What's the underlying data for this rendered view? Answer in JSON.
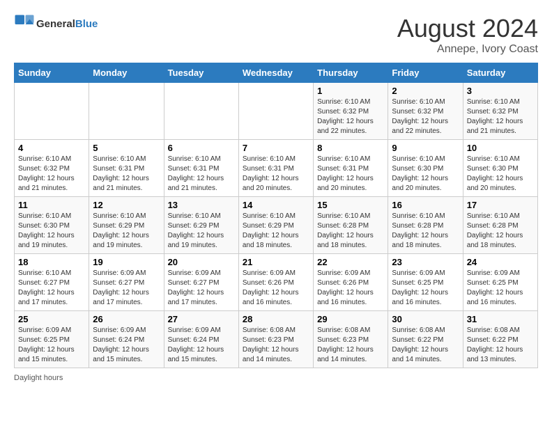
{
  "header": {
    "logo_text_general": "General",
    "logo_text_blue": "Blue",
    "month_year": "August 2024",
    "location": "Annepe, Ivory Coast"
  },
  "days_of_week": [
    "Sunday",
    "Monday",
    "Tuesday",
    "Wednesday",
    "Thursday",
    "Friday",
    "Saturday"
  ],
  "legend": "Daylight hours",
  "weeks": [
    [
      {
        "num": "",
        "info": ""
      },
      {
        "num": "",
        "info": ""
      },
      {
        "num": "",
        "info": ""
      },
      {
        "num": "",
        "info": ""
      },
      {
        "num": "1",
        "info": "Sunrise: 6:10 AM\nSunset: 6:32 PM\nDaylight: 12 hours and 22 minutes."
      },
      {
        "num": "2",
        "info": "Sunrise: 6:10 AM\nSunset: 6:32 PM\nDaylight: 12 hours and 22 minutes."
      },
      {
        "num": "3",
        "info": "Sunrise: 6:10 AM\nSunset: 6:32 PM\nDaylight: 12 hours and 21 minutes."
      }
    ],
    [
      {
        "num": "4",
        "info": "Sunrise: 6:10 AM\nSunset: 6:32 PM\nDaylight: 12 hours and 21 minutes."
      },
      {
        "num": "5",
        "info": "Sunrise: 6:10 AM\nSunset: 6:31 PM\nDaylight: 12 hours and 21 minutes."
      },
      {
        "num": "6",
        "info": "Sunrise: 6:10 AM\nSunset: 6:31 PM\nDaylight: 12 hours and 21 minutes."
      },
      {
        "num": "7",
        "info": "Sunrise: 6:10 AM\nSunset: 6:31 PM\nDaylight: 12 hours and 20 minutes."
      },
      {
        "num": "8",
        "info": "Sunrise: 6:10 AM\nSunset: 6:31 PM\nDaylight: 12 hours and 20 minutes."
      },
      {
        "num": "9",
        "info": "Sunrise: 6:10 AM\nSunset: 6:30 PM\nDaylight: 12 hours and 20 minutes."
      },
      {
        "num": "10",
        "info": "Sunrise: 6:10 AM\nSunset: 6:30 PM\nDaylight: 12 hours and 20 minutes."
      }
    ],
    [
      {
        "num": "11",
        "info": "Sunrise: 6:10 AM\nSunset: 6:30 PM\nDaylight: 12 hours and 19 minutes."
      },
      {
        "num": "12",
        "info": "Sunrise: 6:10 AM\nSunset: 6:29 PM\nDaylight: 12 hours and 19 minutes."
      },
      {
        "num": "13",
        "info": "Sunrise: 6:10 AM\nSunset: 6:29 PM\nDaylight: 12 hours and 19 minutes."
      },
      {
        "num": "14",
        "info": "Sunrise: 6:10 AM\nSunset: 6:29 PM\nDaylight: 12 hours and 18 minutes."
      },
      {
        "num": "15",
        "info": "Sunrise: 6:10 AM\nSunset: 6:28 PM\nDaylight: 12 hours and 18 minutes."
      },
      {
        "num": "16",
        "info": "Sunrise: 6:10 AM\nSunset: 6:28 PM\nDaylight: 12 hours and 18 minutes."
      },
      {
        "num": "17",
        "info": "Sunrise: 6:10 AM\nSunset: 6:28 PM\nDaylight: 12 hours and 18 minutes."
      }
    ],
    [
      {
        "num": "18",
        "info": "Sunrise: 6:10 AM\nSunset: 6:27 PM\nDaylight: 12 hours and 17 minutes."
      },
      {
        "num": "19",
        "info": "Sunrise: 6:09 AM\nSunset: 6:27 PM\nDaylight: 12 hours and 17 minutes."
      },
      {
        "num": "20",
        "info": "Sunrise: 6:09 AM\nSunset: 6:27 PM\nDaylight: 12 hours and 17 minutes."
      },
      {
        "num": "21",
        "info": "Sunrise: 6:09 AM\nSunset: 6:26 PM\nDaylight: 12 hours and 16 minutes."
      },
      {
        "num": "22",
        "info": "Sunrise: 6:09 AM\nSunset: 6:26 PM\nDaylight: 12 hours and 16 minutes."
      },
      {
        "num": "23",
        "info": "Sunrise: 6:09 AM\nSunset: 6:25 PM\nDaylight: 12 hours and 16 minutes."
      },
      {
        "num": "24",
        "info": "Sunrise: 6:09 AM\nSunset: 6:25 PM\nDaylight: 12 hours and 16 minutes."
      }
    ],
    [
      {
        "num": "25",
        "info": "Sunrise: 6:09 AM\nSunset: 6:25 PM\nDaylight: 12 hours and 15 minutes."
      },
      {
        "num": "26",
        "info": "Sunrise: 6:09 AM\nSunset: 6:24 PM\nDaylight: 12 hours and 15 minutes."
      },
      {
        "num": "27",
        "info": "Sunrise: 6:09 AM\nSunset: 6:24 PM\nDaylight: 12 hours and 15 minutes."
      },
      {
        "num": "28",
        "info": "Sunrise: 6:08 AM\nSunset: 6:23 PM\nDaylight: 12 hours and 14 minutes."
      },
      {
        "num": "29",
        "info": "Sunrise: 6:08 AM\nSunset: 6:23 PM\nDaylight: 12 hours and 14 minutes."
      },
      {
        "num": "30",
        "info": "Sunrise: 6:08 AM\nSunset: 6:22 PM\nDaylight: 12 hours and 14 minutes."
      },
      {
        "num": "31",
        "info": "Sunrise: 6:08 AM\nSunset: 6:22 PM\nDaylight: 12 hours and 13 minutes."
      }
    ]
  ]
}
